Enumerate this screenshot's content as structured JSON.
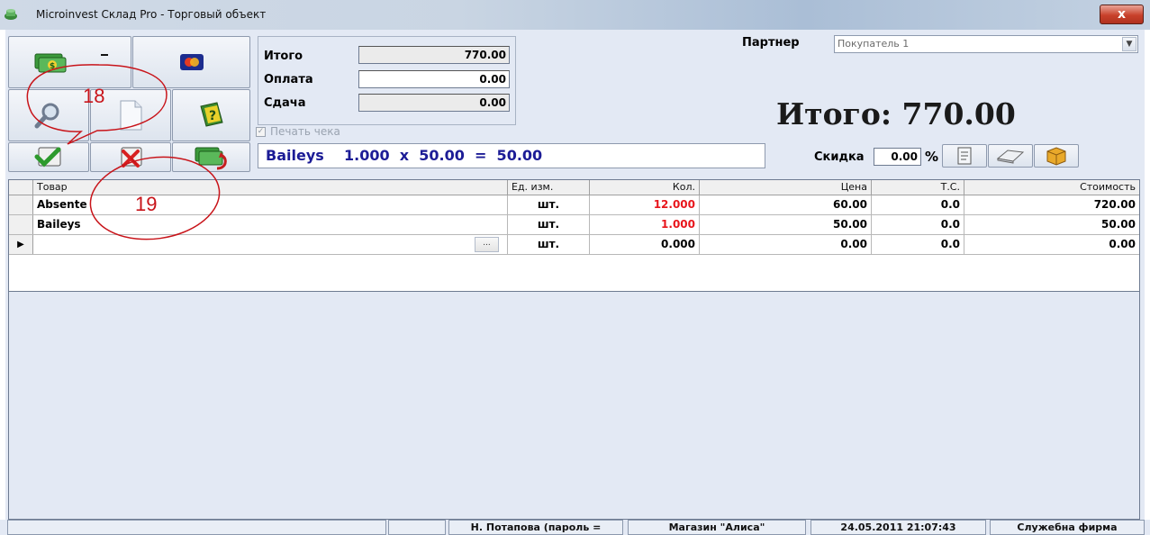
{
  "window": {
    "title": "Microinvest Склад Pro - Торговый объект",
    "close_glyph": "x"
  },
  "totals": {
    "total_label": "Итого",
    "total_value": "770.00",
    "payment_label": "Оплата",
    "payment_value": "0.00",
    "change_label": "Сдача",
    "change_value": "0.00",
    "print_receipt_label": "Печать чека",
    "print_receipt_checked": true
  },
  "item_display": "Baileys    1.000  x  50.00  =  50.00",
  "partner": {
    "label": "Партнер",
    "value": "Покупатель 1"
  },
  "big_total": "Итого:  770.00",
  "discount": {
    "label": "Скидка",
    "value": "0.00",
    "unit": "%"
  },
  "grid": {
    "columns": [
      "Товар",
      "Ед. изм.",
      "Кол.",
      "Цена",
      "Т.С.",
      "Стоимость"
    ],
    "rows": [
      {
        "product": "Absente",
        "unit": "шт.",
        "qty": "12.000",
        "price": "60.00",
        "tax": "0.0",
        "amount": "720.00"
      },
      {
        "product": "Baileys",
        "unit": "шт.",
        "qty": "1.000",
        "price": "50.00",
        "tax": "0.0",
        "amount": "50.00"
      },
      {
        "product": "",
        "unit": "шт.",
        "qty": "0.000",
        "price": "0.00",
        "tax": "0.0",
        "amount": "0.00"
      }
    ],
    "ellipsis": "...",
    "current_row_marker": "▶"
  },
  "annotations": {
    "a18": "18",
    "a19": "19"
  },
  "status": {
    "user": "Н. Потапова  (пароль =",
    "store": "Магазин \"Алиса\"",
    "datetime": "24.05.2011 21:07:43",
    "company": "Служебна фирма"
  },
  "colors": {
    "accent_blue": "#1c1c96",
    "qty_red": "#e8161c",
    "annotation_red": "#c8141a",
    "window_bg": "#e3e9f4"
  },
  "icons": [
    "app-icon",
    "cash-icon",
    "card-icon",
    "search-icon",
    "document-icon",
    "help-book-icon",
    "confirm-check-icon",
    "cancel-x-icon",
    "cash-return-icon",
    "note-icon",
    "eraser-icon",
    "box-icon"
  ]
}
